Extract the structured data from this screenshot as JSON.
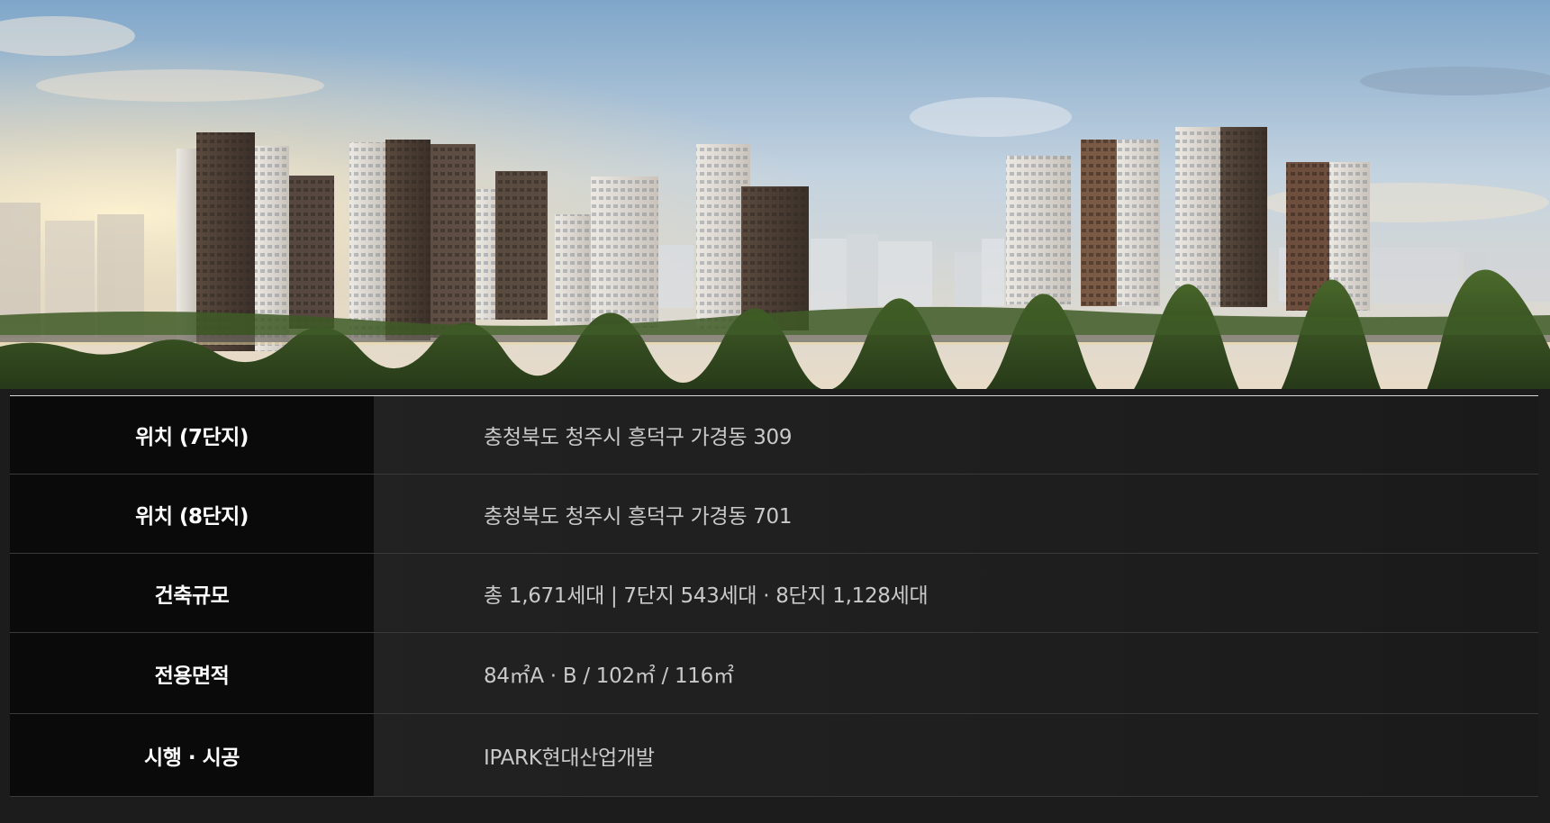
{
  "hero": {
    "image": "apartment-complex-rendering"
  },
  "info_table": {
    "rows": [
      {
        "label": "위치 (7단지)",
        "value": "충청북도 청주시 흥덕구 가경동 309"
      },
      {
        "label": "위치 (8단지)",
        "value": "충청북도 청주시 흥덕구 가경동 701"
      },
      {
        "label": "건축규모",
        "value": "총 1,671세대 | 7단지 543세대 · 8단지 1,128세대"
      },
      {
        "label": "전용면적",
        "value": "84㎡A · B / 102㎡ / 116㎡"
      },
      {
        "label": "시행 · 시공",
        "value": "IPARK현대산업개발"
      }
    ]
  },
  "colors": {
    "label_bg": "#0a0a0a",
    "value_bg": "#1f1f1f",
    "label_text": "#ffffff",
    "value_text": "#c9c9c9"
  }
}
